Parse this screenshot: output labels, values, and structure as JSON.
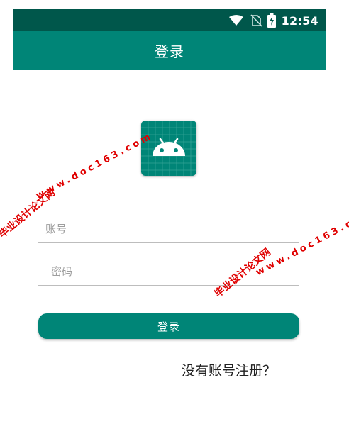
{
  "status_bar": {
    "time": "12:54",
    "icons": [
      "wifi-icon",
      "no-sim-icon",
      "battery-charging-icon"
    ]
  },
  "app_bar": {
    "title": "登录"
  },
  "form": {
    "account_placeholder": "账号",
    "password_placeholder": "密码",
    "login_button": "登录",
    "register_link": "没有账号注册？"
  },
  "watermarks": {
    "brand": "毕业设计论文网",
    "url": "www.doc163.com"
  },
  "colors": {
    "primary": "#008577",
    "primary_dark": "#00574b",
    "watermark": "#e00000"
  }
}
